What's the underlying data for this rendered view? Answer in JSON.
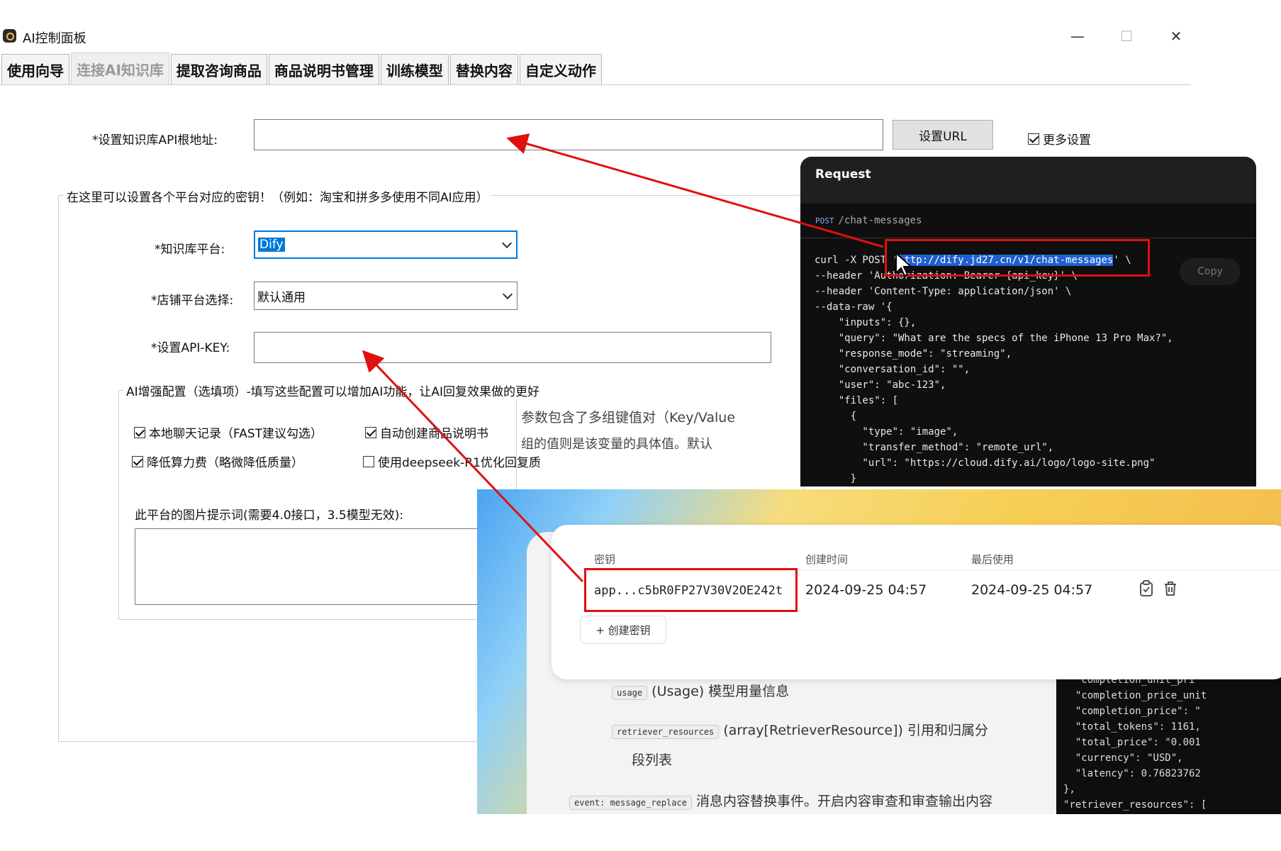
{
  "window": {
    "title": "AI控制面板",
    "controls": {
      "minimize": "—",
      "maximize": "☐",
      "close": "✕"
    }
  },
  "tabs": [
    {
      "label": "使用向导",
      "active": false
    },
    {
      "label": "连接AI知识库",
      "active": true
    },
    {
      "label": "提取咨询商品",
      "active": false
    },
    {
      "label": "商品说明书管理",
      "active": false
    },
    {
      "label": "训练模型",
      "active": false
    },
    {
      "label": "替换内容",
      "active": false
    },
    {
      "label": "自定义动作",
      "active": false
    }
  ],
  "form": {
    "api_url_label": "*设置知识库API根地址:",
    "api_url_value": "",
    "set_url_button": "设置URL",
    "more_settings_label": "更多设置",
    "platform_group_legend": "在这里可以设置各个平台对应的密钥！（例如：淘宝和拼多多使用不同AI应用）",
    "kb_platform_label": "*知识库平台:",
    "kb_platform_value": "Dify",
    "shop_platform_label": "*店铺平台选择:",
    "shop_platform_value": "默认通用",
    "api_key_label": "*设置API-KEY:",
    "api_key_value": "",
    "enhance_group_legend": "AI增强配置（选填项）-填写这些配置可以增加AI功能，让AI回复效果做的更好",
    "options": [
      {
        "label": "本地聊天记录（FAST建议勾选）",
        "checked": true
      },
      {
        "label": "自动创建商品说明书",
        "checked": true
      },
      {
        "label": "降低算力费（略微降低质量）",
        "checked": true
      },
      {
        "label": "使用deepseek-R1优化回复质",
        "checked": false
      }
    ],
    "image_prompt_label": "此平台的图片提示词(需要4.0接口，3.5模型无效):",
    "image_prompt_value": "",
    "partial_text_1": "参数包含了多组键值对（Key/Value",
    "partial_text_2": "组的值则是该变量的具体值。默认"
  },
  "request_panel": {
    "title": "Request",
    "method": "POST",
    "path": "/chat-messages",
    "copy_label": "Copy",
    "code_line_1_pre": "curl -X POST '",
    "code_line_1_url": "http://dify.jd27.cn/v1/chat-messages",
    "code_line_1_post": "' \\",
    "code_rest": "--header 'Authorization: Bearer {api_key}' \\\n--header 'Content-Type: application/json' \\\n--data-raw '{\n    \"inputs\": {},\n    \"query\": \"What are the specs of the iPhone 13 Pro Max?\",\n    \"response_mode\": \"streaming\",\n    \"conversation_id\": \"\",\n    \"user\": \"abc-123\",\n    \"files\": [\n      {\n        \"type\": \"image\",\n        \"transfer_method\": \"remote_url\",\n        \"url\": \"https://cloud.dify.ai/logo/logo-site.png\"\n      }"
  },
  "key_card": {
    "headers": {
      "key": "密钥",
      "created": "创建时间",
      "last_used": "最后使用"
    },
    "row": {
      "key": "app...c5bR0FP27V30V2OE242t",
      "created": "2024-09-25 04:57",
      "last_used": "2024-09-25 04:57"
    },
    "create_button": "+ 创建密钥"
  },
  "doc_background": {
    "usage_chip": "usage",
    "usage_text": "(Usage) 模型用量信息",
    "retriever_chip": "retriever_resources",
    "retriever_text": "(array[RetrieverResource]) 引用和归属分",
    "retriever_text_2": "段列表",
    "event_chip": "event: message_replace",
    "event_text": "消息内容替换事件。开启内容审查和审查输出内容",
    "code": "  \"completion_unit_pri\n  \"completion_price_unit\n  \"completion_price\": \"\n  \"total_tokens\": 1161,\n  \"total_price\": \"0.001\n  \"currency\": \"USD\",\n  \"latency\": 0.76823762\n},\n\"retriever_resources\": ["
  },
  "colors": {
    "annotation": "#e01010",
    "selection": "#0078d7",
    "url_highlight": "#1f5fd1"
  }
}
